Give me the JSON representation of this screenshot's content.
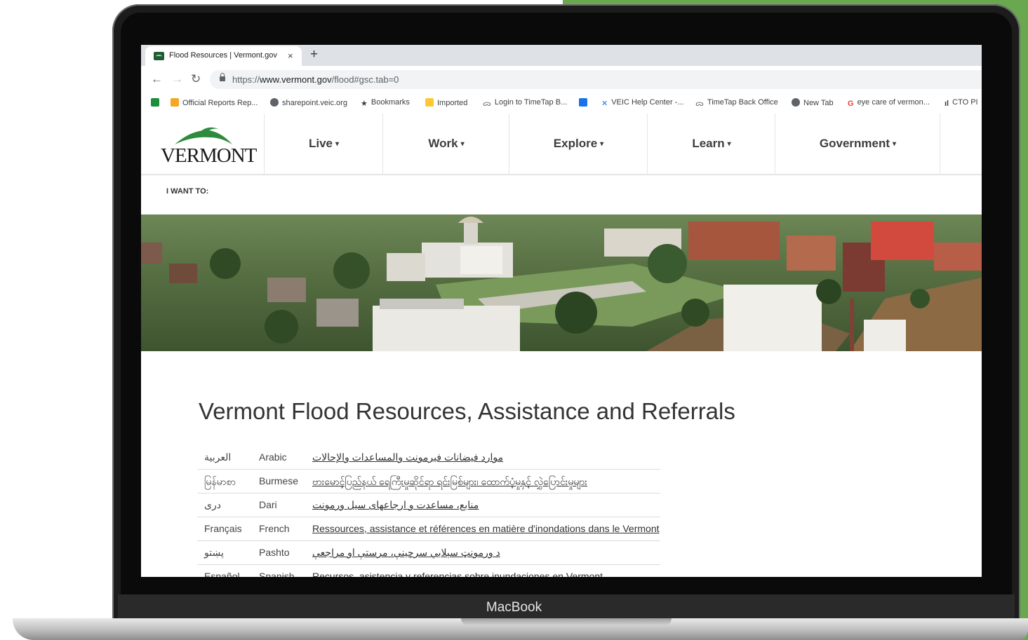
{
  "browser": {
    "tab_title": "Flood Resources | Vermont.gov",
    "tab_close": "×",
    "new_tab": "+",
    "url_prefix": "https://",
    "url_host": "www.vermont.gov",
    "url_path": "/flood#gsc.tab=0",
    "bookmarks": [
      {
        "label": "Official Reports Rep...",
        "color": "#f5a623"
      },
      {
        "label": "sharepoint.veic.org",
        "color": "#5f6368"
      },
      {
        "label": "Bookmarks",
        "color": "#3c4043"
      },
      {
        "label": "Imported",
        "color": "#fcc934"
      },
      {
        "label": "Login to TimeTap B...",
        "color": "#5f6368"
      },
      {
        "label": "VEIC Help Center -...",
        "color": "#1a73e8"
      },
      {
        "label": "TimeTap Back Office",
        "color": "#5f6368"
      },
      {
        "label": "New Tab",
        "color": "#5f6368"
      },
      {
        "label": "eye care of vermon...",
        "color": "#ea4335"
      },
      {
        "label": "CTO PI",
        "color": "#202124"
      }
    ]
  },
  "site": {
    "logo_text": "VERMONT",
    "nav": [
      "Live",
      "Work",
      "Explore",
      "Learn",
      "Government"
    ],
    "i_want_to": "I WANT TO:"
  },
  "main": {
    "title": "Vermont Flood Resources, Assistance and Referrals",
    "languages": [
      {
        "native": "العربية",
        "english": "Arabic",
        "link": "موارد فيضانات فيرمونت والمساعدات والإحالات"
      },
      {
        "native": "မြန်မာစာ",
        "english": "Burmese",
        "link": "ဗားမောင့်ပြည်နယ် ရေကြီးမှုဆိုင်ရာ ရင်းမြစ်များ၊ ထောက်ပံ့မှုနှင့် လွှဲပြောင်းမှုများ"
      },
      {
        "native": "دری",
        "english": "Dari",
        "link": "منابع، مساعدت و ارجاعهای سیل ورمونت"
      },
      {
        "native": "Français",
        "english": "French",
        "link": "Ressources, assistance et références en matière d'inondations dans le Vermont"
      },
      {
        "native": "پښتو",
        "english": "Pashto",
        "link": "د ورمونټ سېلابي سرچينې، مرستې او مراجعې"
      },
      {
        "native": "Español",
        "english": "Spanish",
        "link": "Recursos, asistencia y referencias sobre inundaciones en Vermont"
      }
    ]
  },
  "device": {
    "brand": "MacBook"
  }
}
